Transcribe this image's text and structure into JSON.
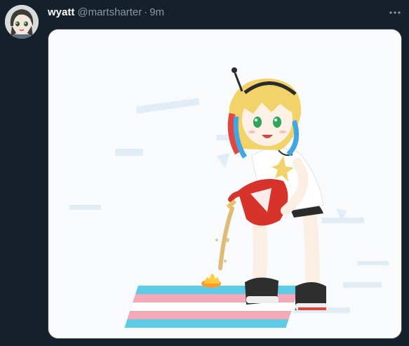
{
  "tweet": {
    "display_name": "wyatt",
    "handle": "@martsharter",
    "separator": "·",
    "timestamp": "9m"
  },
  "icons": {
    "more": "more-horizontal-icon"
  },
  "colors": {
    "background": "#15202b",
    "name_text": "#ffffff",
    "secondary_text": "#8899a6",
    "media_border": "#38444d"
  }
}
